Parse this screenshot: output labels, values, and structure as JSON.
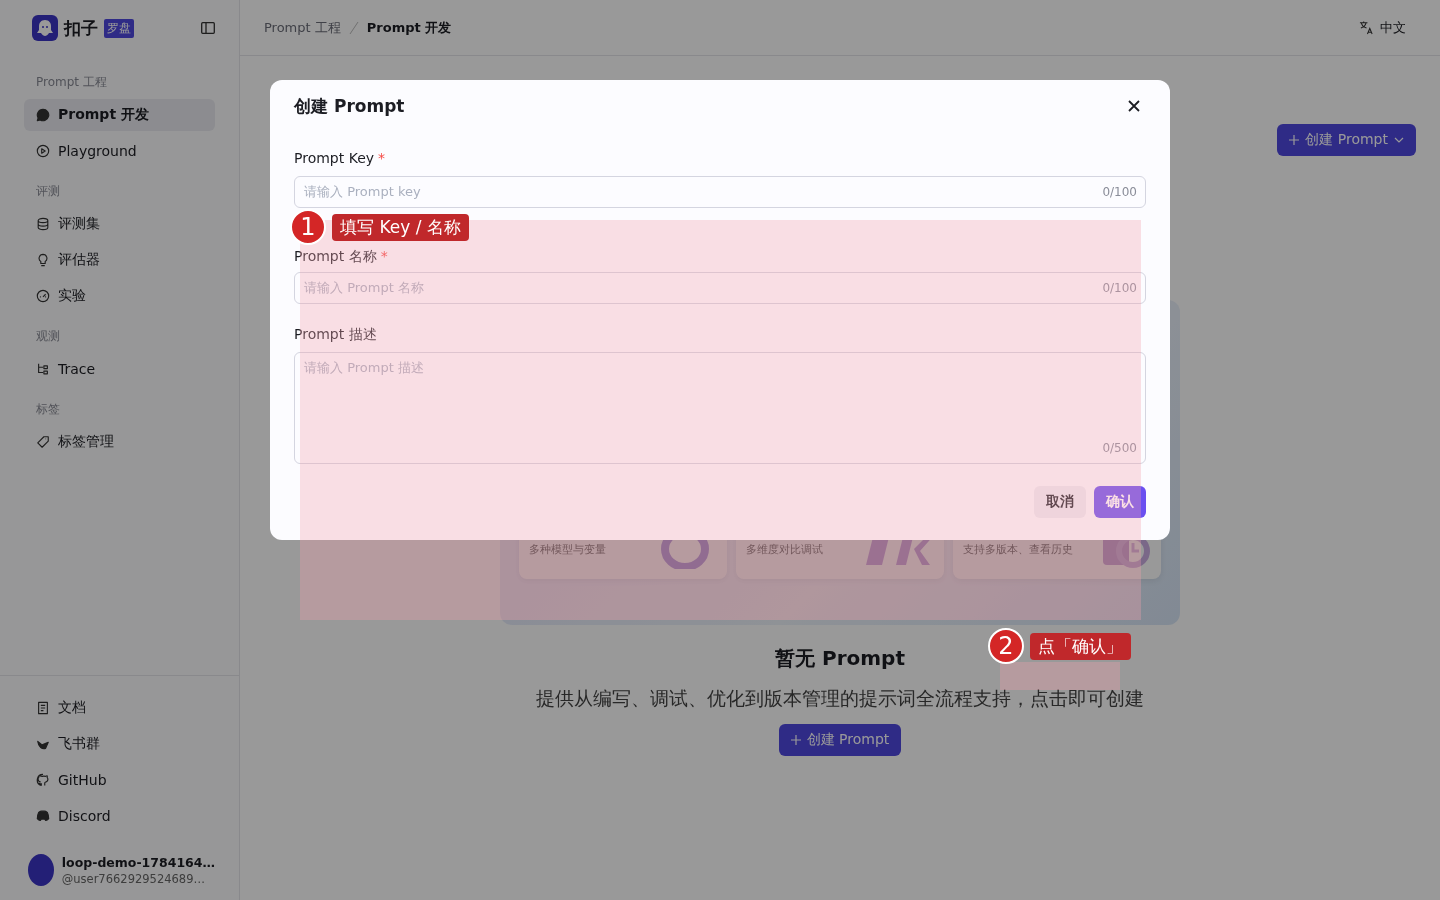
{
  "brand": {
    "name": "扣子",
    "badge": "罗盘"
  },
  "breadcrumb": [
    {
      "label": "Prompt 工程",
      "current": false
    },
    {
      "label": "Prompt 开发",
      "current": true
    }
  ],
  "language": "中文",
  "sidebar": {
    "sections": [
      {
        "title": "Prompt 工程",
        "items": [
          {
            "label": "Prompt 开发",
            "selected": true
          },
          {
            "label": "Playground",
            "selected": false
          }
        ]
      },
      {
        "title": "评测",
        "items": [
          {
            "label": "评测集",
            "selected": false
          },
          {
            "label": "评估器",
            "selected": false
          },
          {
            "label": "实验",
            "selected": false
          }
        ]
      },
      {
        "title": "观测",
        "items": [
          {
            "label": "Trace",
            "selected": false
          }
        ]
      },
      {
        "title": "标签",
        "items": [
          {
            "label": "标签管理",
            "selected": false
          }
        ]
      }
    ],
    "footer_items": [
      {
        "label": "文档"
      },
      {
        "label": "飞书群"
      },
      {
        "label": "GitHub"
      },
      {
        "label": "Discord"
      }
    ],
    "user": {
      "name": "loop-demo-1784164…",
      "handle": "@user7662929524689…"
    }
  },
  "page": {
    "create_button": "创建 Prompt",
    "features": [
      {
        "text": "多种模型与变量"
      },
      {
        "text": "多维度对比调试"
      },
      {
        "text": "支持多版本、查看历史"
      }
    ],
    "empty_title": "暂无 Prompt",
    "empty_description": "提供从编写、调试、优化到版本管理的提示词全流程支持，点击即可创建",
    "empty_button": "创建 Prompt"
  },
  "dialog": {
    "title": "创建 Prompt",
    "fields": [
      {
        "kind": "input",
        "label": "Prompt Key",
        "required_mark": "*",
        "placeholder": "请输入 Prompt key",
        "counter": "0/100"
      },
      {
        "kind": "input",
        "label": "Prompt 名称",
        "required_mark": "*",
        "placeholder": "请输入 Prompt 名称",
        "counter": "0/100"
      },
      {
        "kind": "textarea",
        "label": "Prompt 描述",
        "placeholder": "请输入 Prompt 描述",
        "counter": "0/500"
      }
    ],
    "buttons": [
      {
        "kind": "secondary",
        "label": "取消"
      },
      {
        "kind": "primary",
        "label": "确认"
      }
    ]
  },
  "annotations": [
    {
      "number": "1",
      "text": "填写 Key / 名称"
    },
    {
      "number": "2",
      "text": "点「确认」"
    }
  ]
}
